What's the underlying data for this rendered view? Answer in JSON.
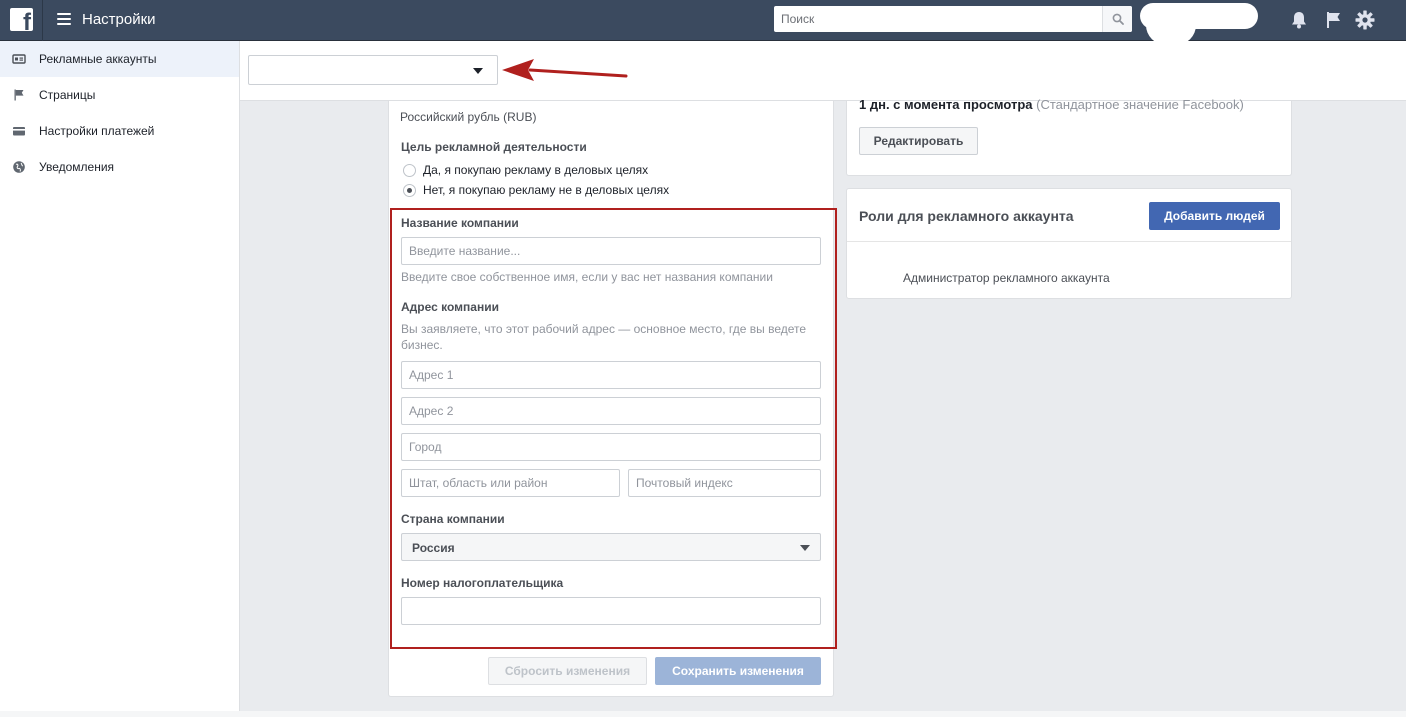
{
  "header": {
    "app_title": "Настройки",
    "search_placeholder": "Поиск"
  },
  "sidebar": {
    "items": [
      {
        "label": "Рекламные аккаунты",
        "icon": "ad-account-icon",
        "active": true
      },
      {
        "label": "Страницы",
        "icon": "flag-icon",
        "active": false
      },
      {
        "label": "Настройки платежей",
        "icon": "credit-card-icon",
        "active": false
      },
      {
        "label": "Уведомления",
        "icon": "globe-icon",
        "active": false
      }
    ]
  },
  "form": {
    "currency": "Российский рубль (RUB)",
    "purpose_label": "Цель рекламной деятельности",
    "purpose_options": [
      {
        "label": "Да, я покупаю рекламу в деловых целях",
        "checked": false
      },
      {
        "label": "Нет, я покупаю рекламу не в деловых целях",
        "checked": true
      }
    ],
    "company_name_label": "Название компании",
    "company_name_placeholder": "Введите название...",
    "company_name_hint": "Введите свое собственное имя, если у вас нет названия компании",
    "address_label": "Адрес компании",
    "address_hint": "Вы заявляете, что этот рабочий адрес — основное место, где вы ведете бизнес.",
    "address1_placeholder": "Адрес 1",
    "address2_placeholder": "Адрес 2",
    "city_placeholder": "Город",
    "state_placeholder": "Штат, область или район",
    "zip_placeholder": "Почтовый индекс",
    "country_label": "Страна компании",
    "country_value": "Россия",
    "tax_label": "Номер налогоплательщика",
    "tax_value": "",
    "reset_label": "Сбросить изменения",
    "save_label": "Сохранить изменения"
  },
  "attribution": {
    "text": "1 дн. с момента просмотра",
    "note": "(Стандартное значение Facebook)",
    "edit_label": "Редактировать"
  },
  "roles": {
    "title": "Роли для рекламного аккаунта",
    "add_label": "Добавить людей",
    "role_text": "Администратор рекламного аккаунта"
  },
  "colors": {
    "topbar": "#3b4a5f",
    "highlight": "#b0201e",
    "primary_button": "#4267b2"
  }
}
